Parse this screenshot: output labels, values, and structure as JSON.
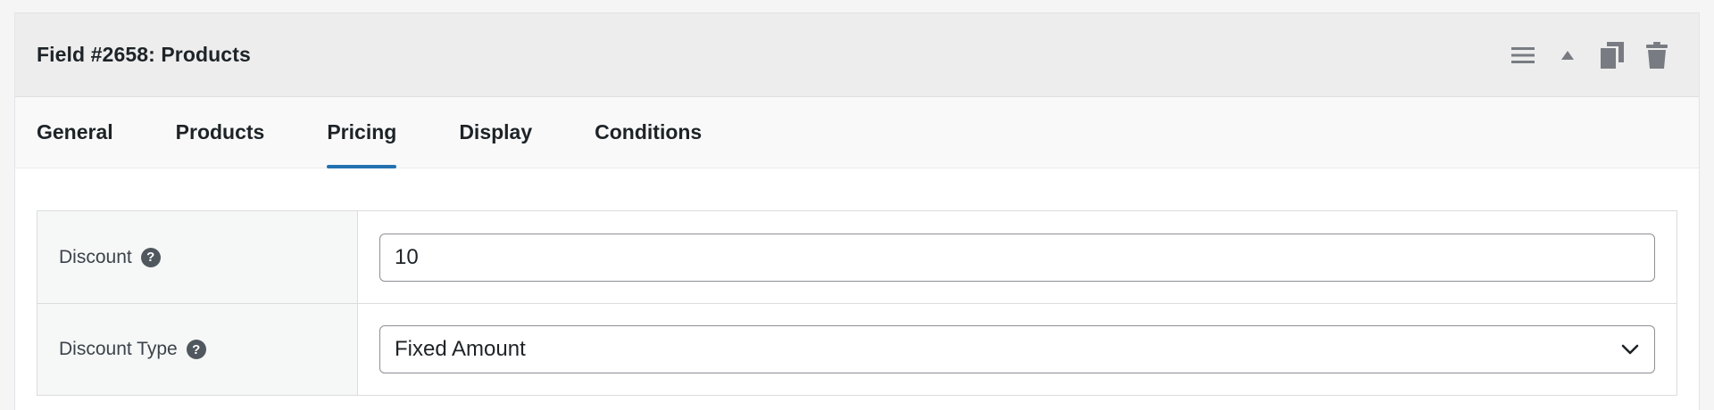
{
  "header": {
    "title": "Field #2658: Products",
    "actions": [
      {
        "icon": "menu-icon"
      },
      {
        "icon": "collapse-arrow-icon"
      },
      {
        "icon": "duplicate-icon"
      },
      {
        "icon": "trash-icon"
      }
    ]
  },
  "tabs": [
    {
      "label": "General",
      "active": false
    },
    {
      "label": "Products",
      "active": false
    },
    {
      "label": "Pricing",
      "active": true
    },
    {
      "label": "Display",
      "active": false
    },
    {
      "label": "Conditions",
      "active": false
    }
  ],
  "fields": {
    "discount": {
      "label": "Discount",
      "value": "10",
      "help": "?"
    },
    "discount_type": {
      "label": "Discount Type",
      "selected": "Fixed Amount",
      "help": "?"
    }
  },
  "colors": {
    "accent": "#2271b1",
    "header_bg": "#ededed",
    "icon": "#787c82"
  }
}
